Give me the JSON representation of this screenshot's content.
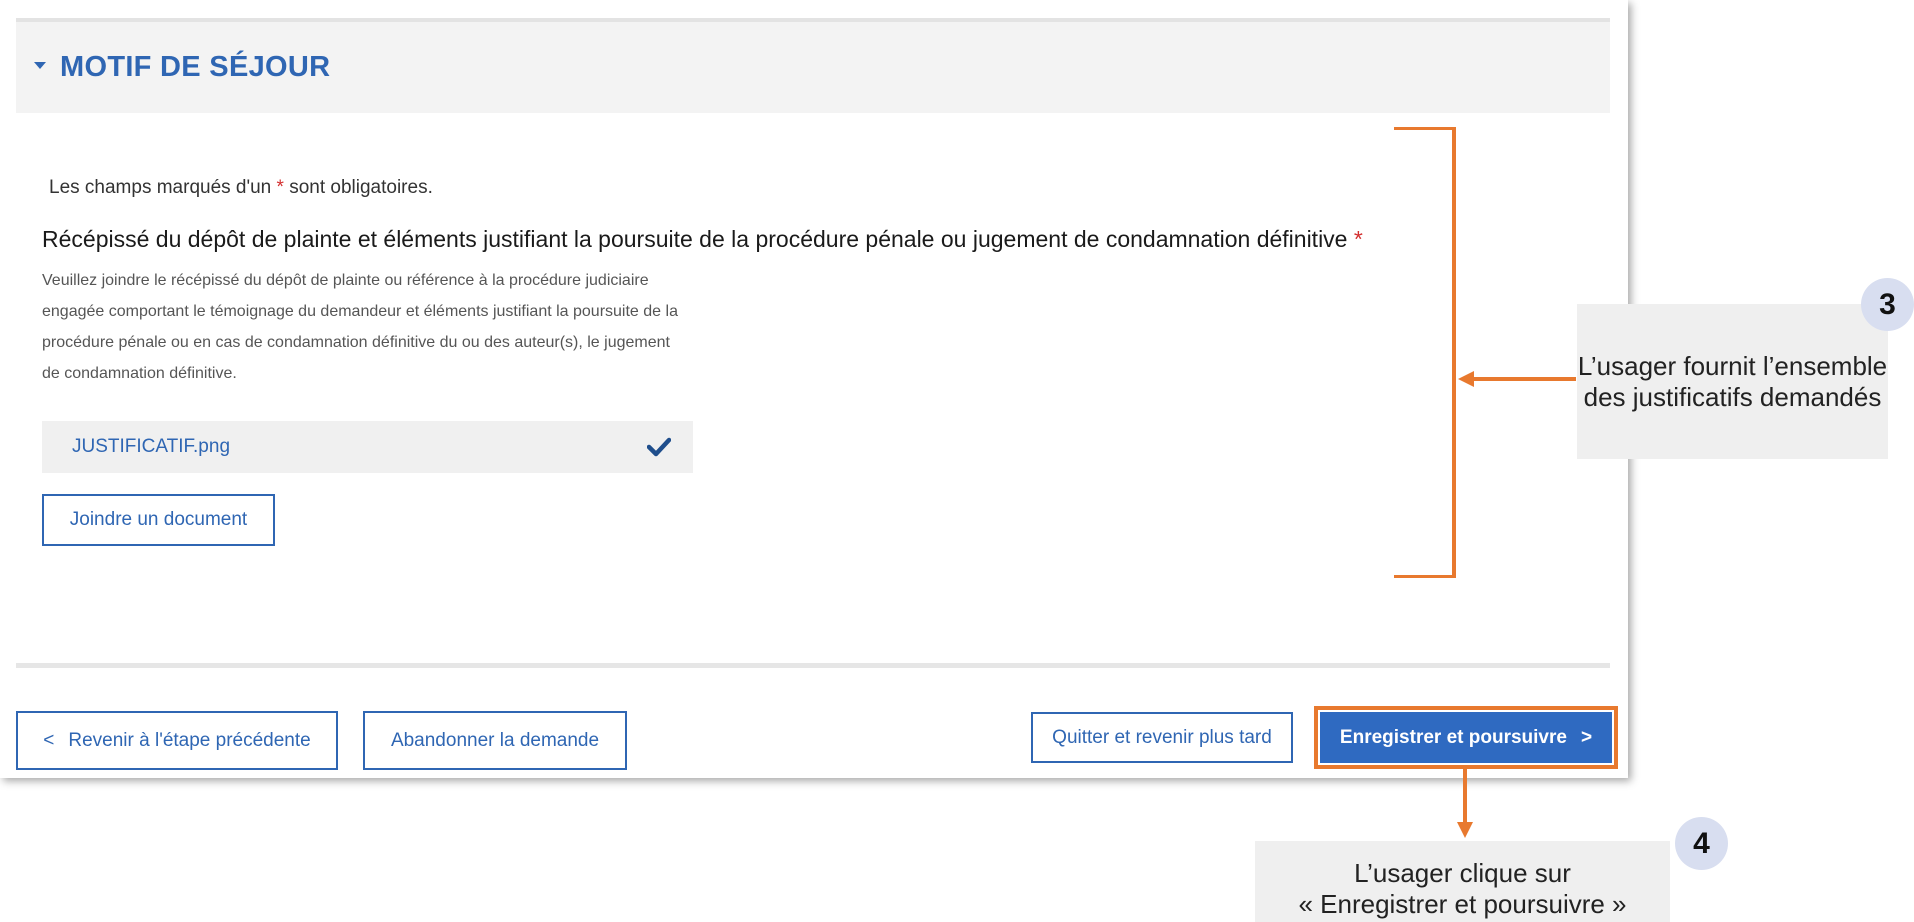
{
  "section": {
    "title": "MOTIF DE SÉJOUR"
  },
  "form": {
    "required_note_prefix": "Les champs marqués d'un ",
    "required_mark": "*",
    "required_note_suffix": " sont obligatoires.",
    "field_title": "Récépissé du dépôt de plainte et éléments justifiant la poursuite de la procédure pénale ou jugement de condamnation définitive ",
    "field_help": "Veuillez joindre le récépissé du dépôt de plainte ou référence à la procédure judiciaire engagée comportant le témoignage du demandeur et éléments justifiant la poursuite de la procédure pénale ou en cas de condamnation définitive du ou des auteur(s), le jugement de condamnation définitive.",
    "file_name": "JUSTIFICATIF.png",
    "attach_label": "Joindre un document"
  },
  "footer": {
    "back_arrow": "<",
    "back_label": "Revenir à l'étape précédente",
    "abandon_label": "Abandonner la demande",
    "quit_label": "Quitter et revenir plus tard",
    "save_label": "Enregistrer et poursuivre",
    "save_arrow": ">"
  },
  "annotations": {
    "step3_number": "3",
    "step3_text": "L’usager fournit l’ensemble des justificatifs demandés",
    "step4_number": "4",
    "step4_line1": "L’usager clique sur",
    "step4_line2": "« Enregistrer et poursuivre »"
  },
  "colors": {
    "primary": "#2f66b3",
    "accent_orange": "#e8792e",
    "required_red": "#d32f2f",
    "badge_bg": "#d8def0"
  },
  "icons": {
    "section_toggle": "caret-down-icon",
    "file_status": "check-icon"
  }
}
